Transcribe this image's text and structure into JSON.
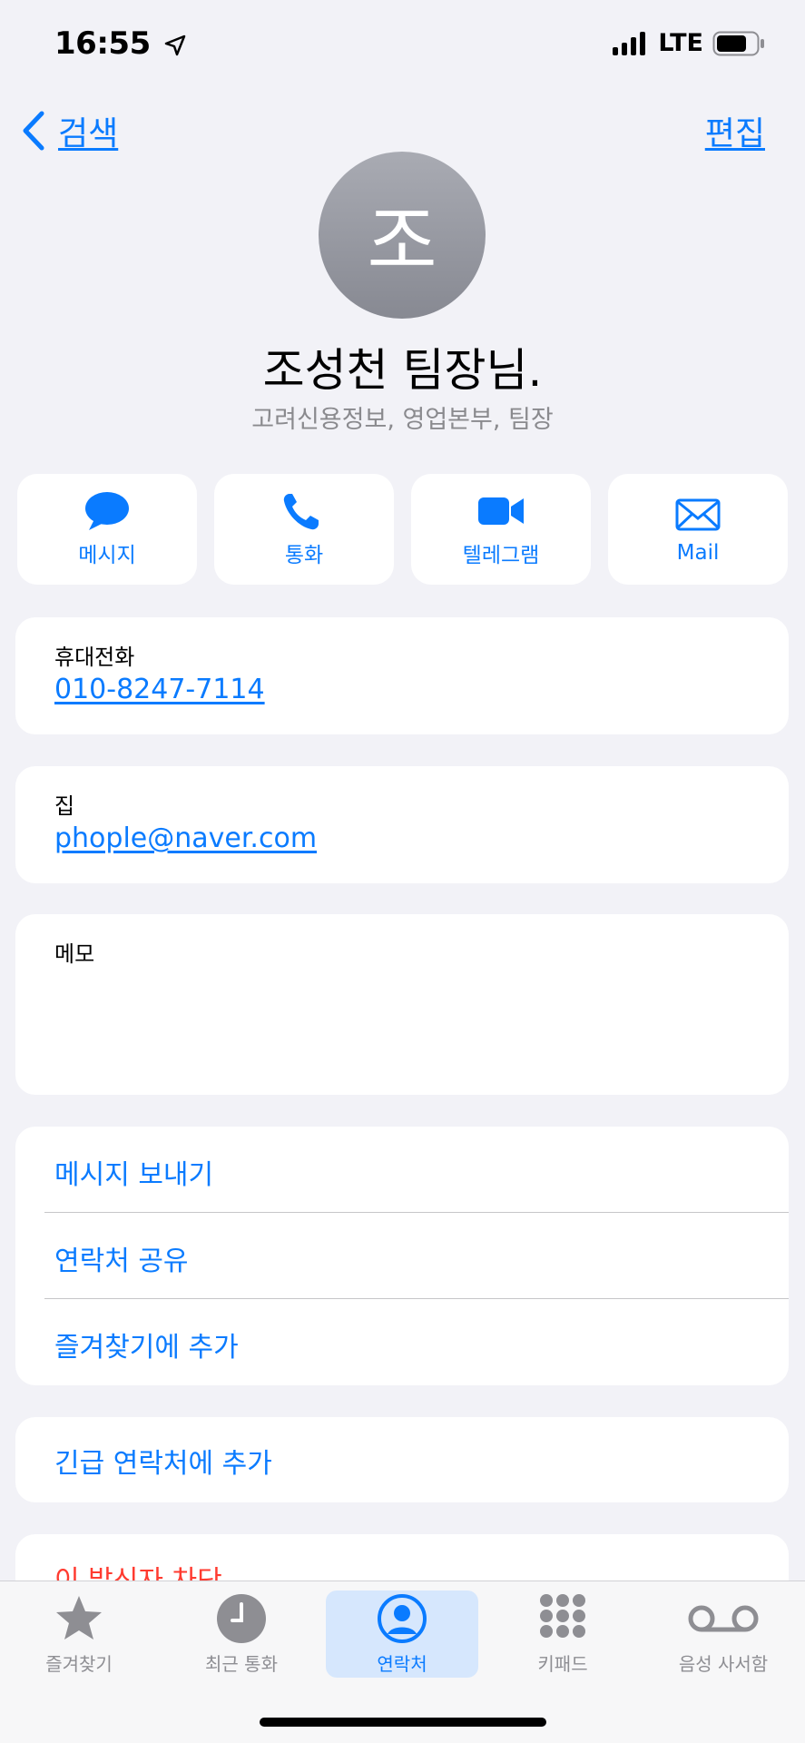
{
  "status_bar": {
    "time": "16:55",
    "network": "LTE",
    "battery_percent": 70
  },
  "nav": {
    "back_label": "검색",
    "edit_label": "편집"
  },
  "contact": {
    "initial": "조",
    "name": "조성천 팀장님.",
    "subtitle": "고려신용정보, 영업본부, 팀장"
  },
  "actions": [
    {
      "label": "메시지",
      "icon": "message-bubble-icon"
    },
    {
      "label": "통화",
      "icon": "phone-icon"
    },
    {
      "label": "텔레그램",
      "icon": "video-camera-icon"
    },
    {
      "label": "Mail",
      "icon": "envelope-icon"
    }
  ],
  "phone": {
    "label": "휴대전화",
    "value": "010-8247-7114"
  },
  "email": {
    "label": "집",
    "value": "phople@naver.com"
  },
  "notes": {
    "label": "메모",
    "value": ""
  },
  "options": [
    {
      "label": "메시지 보내기"
    },
    {
      "label": "연락처 공유"
    },
    {
      "label": "즐겨찾기에 추가"
    }
  ],
  "emergency": {
    "label": "긴급 연락처에 추가"
  },
  "block": {
    "label": "이 발신자 차단"
  },
  "tabs": [
    {
      "label": "즐겨찾기",
      "icon": "star-icon"
    },
    {
      "label": "최근 통화",
      "icon": "clock-icon"
    },
    {
      "label": "연락처",
      "icon": "person-circle-icon",
      "active": true
    },
    {
      "label": "키패드",
      "icon": "keypad-icon"
    },
    {
      "label": "음성 사서함",
      "icon": "voicemail-icon"
    }
  ],
  "colors": {
    "accent": "#0a7bff",
    "destructive": "#ff3b30",
    "background": "#f2f2f7"
  }
}
